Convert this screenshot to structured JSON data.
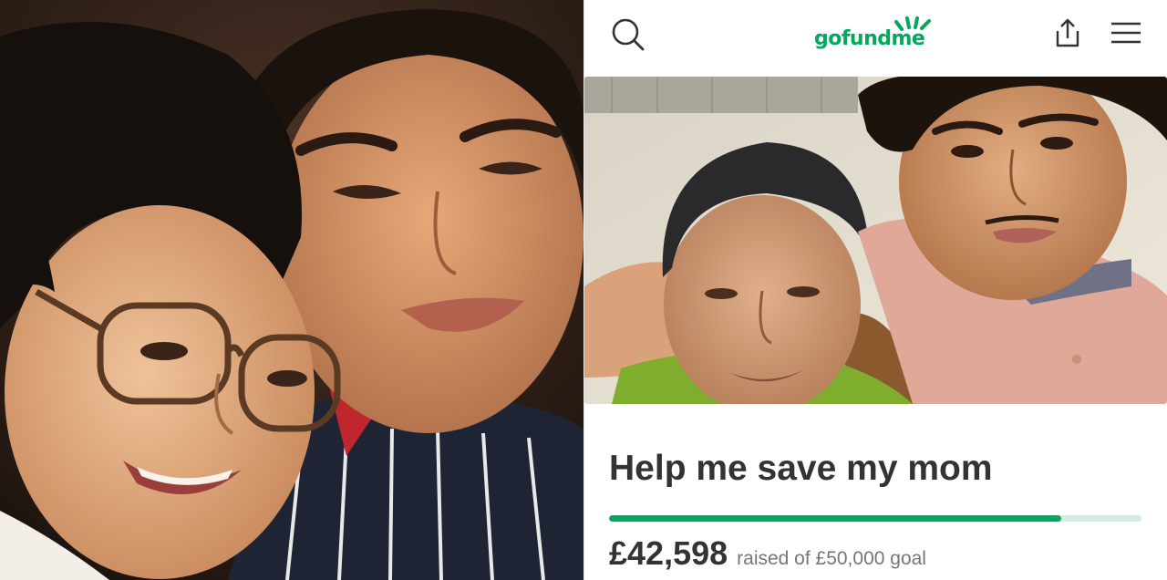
{
  "header": {
    "logo_text": "gofundme",
    "icons": {
      "search": "search-icon",
      "share": "share-icon",
      "menu": "hamburger-menu-icon"
    },
    "brand_color": "#02a95c"
  },
  "campaign": {
    "title": "Help me save my mom",
    "amount_raised": "£42,598",
    "goal_text": "raised of £50,000 goal",
    "progress_fraction": 0.85
  },
  "colors": {
    "accent": "#02a95c",
    "progress_track": "#cfeee0",
    "title_text": "#333333",
    "secondary_text": "#767676"
  }
}
